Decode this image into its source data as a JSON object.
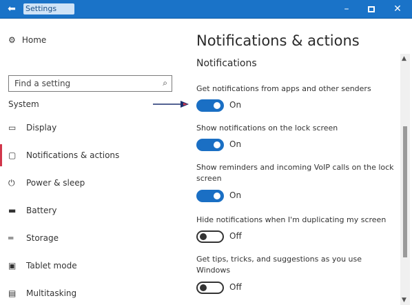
{
  "titlebar": {
    "back_icon": "back-arrow-icon",
    "title": "Settings",
    "minimize": "–",
    "close": "✕"
  },
  "sidebar": {
    "home": {
      "label": "Home",
      "icon": "gear-icon"
    },
    "search": {
      "placeholder": "Find a setting",
      "icon": "search-icon"
    },
    "section": "System",
    "items": [
      {
        "label": "Display",
        "icon": "display-icon"
      },
      {
        "label": "Notifications & actions",
        "icon": "notifications-icon",
        "selected": true
      },
      {
        "label": "Power & sleep",
        "icon": "power-icon"
      },
      {
        "label": "Battery",
        "icon": "battery-icon"
      },
      {
        "label": "Storage",
        "icon": "storage-icon"
      },
      {
        "label": "Tablet mode",
        "icon": "tablet-icon"
      },
      {
        "label": "Multitasking",
        "icon": "multitasking-icon"
      }
    ]
  },
  "main": {
    "title": "Notifications & actions",
    "subtitle": "Notifications",
    "settings": [
      {
        "label": "Get notifications from apps and other senders",
        "state": "On"
      },
      {
        "label": "Show notifications on the lock screen",
        "state": "On"
      },
      {
        "label": "Show reminders and incoming VoIP calls on the lock screen",
        "state": "On"
      },
      {
        "label": "Hide notifications when I'm duplicating my screen",
        "state": "Off"
      },
      {
        "label": "Get tips, tricks, and suggestions as you use Windows",
        "state": "Off"
      }
    ]
  },
  "colors": {
    "accent": "#1a6fc4",
    "titlebar": "#1a73c8",
    "selection_bar": "#d1364a",
    "arrow": "#1a2f6e"
  }
}
